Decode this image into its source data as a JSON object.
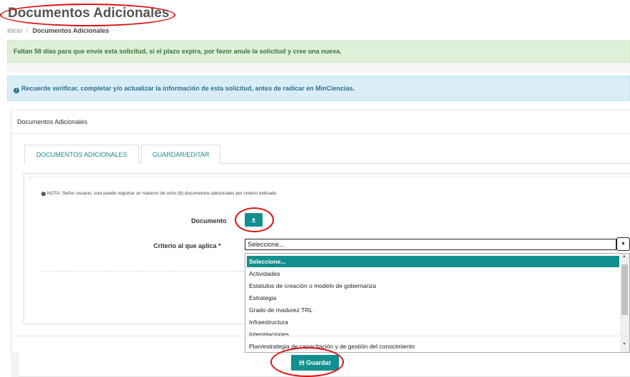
{
  "header": {
    "title": "Documentos Adicionales",
    "breadcrumb": {
      "home": "Inicio",
      "separator": "/",
      "current": "Documentos Adicionales"
    }
  },
  "alerts": {
    "deadline": "Faltan 58 días para que envíe esta solicitud, si el plazo expira, por favor anule la solicitud y cree una nueva.",
    "reminder": "Recuerde verificar, completar y/o actualizar la información de esta solicitud, antes de radicar en MinCiencias."
  },
  "panel": {
    "heading": "Documentos Adicionales",
    "tabs": [
      {
        "label": "DOCUMENTOS ADICIONALES"
      },
      {
        "label": "GUARDAR/EDITAR"
      }
    ]
  },
  "form": {
    "note": "NOTA: Señor usuario, solo puede registrar un máximo de ocho (8) documentos adicionales por criterio indicado.",
    "document_label": "Documento",
    "criterion_label": "Criterio al que aplica *",
    "criterion_value": "Seleccione...",
    "options": [
      "Seleccione...",
      "Actividades",
      "Estatutos de creación o modelo de gobernanza",
      "Estrategia",
      "Grado de madurez TRL",
      "Infraestructura",
      "Interrelaciones",
      "Plan/estrategia de capacitación y de gestión del conocimiento"
    ],
    "save_label": "Guardar"
  },
  "icons": {
    "info": "info-circle-icon",
    "upload": "upload-icon",
    "save": "floppy-disk-icon",
    "dropdown": "caret-down-icon"
  },
  "colors": {
    "accent": "#138f8f",
    "success_bg": "#dff0d8",
    "success_text": "#3c763d",
    "info_bg": "#d9edf7",
    "info_text": "#31708f",
    "annotation": "#dd1111"
  }
}
